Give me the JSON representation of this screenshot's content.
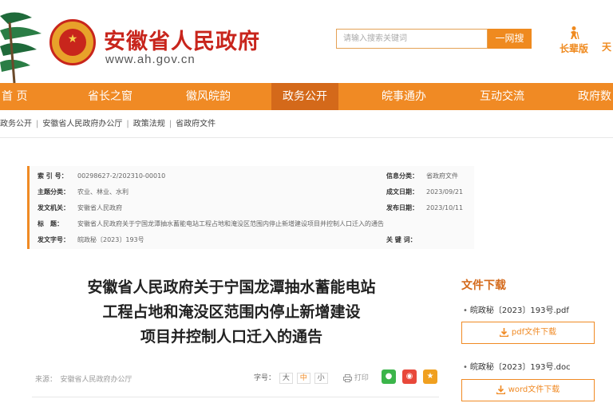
{
  "header": {
    "site_title": "安徽省人民政府",
    "site_url": "www.ah.gov.cn",
    "search_placeholder": "请输入搜索关键词",
    "search_button": "一网搜",
    "elder_mode": "长辈版",
    "extra_link": "天"
  },
  "nav": {
    "items": [
      {
        "label": "首 页"
      },
      {
        "label": "省长之窗"
      },
      {
        "label": "徽风皖韵"
      },
      {
        "label": "政务公开"
      },
      {
        "label": "皖事通办"
      },
      {
        "label": "互动交流"
      },
      {
        "label": "政府数"
      }
    ],
    "active_index": 3
  },
  "breadcrumb": [
    "政务公开",
    "安徽省人民政府办公厅",
    "政策法规",
    "省政府文件"
  ],
  "meta": {
    "index_label": "索 引 号：",
    "index_value": "00298627-2/202310-00010",
    "category_label": "信息分类：",
    "category_value": "省政府文件",
    "topic_label": "主题分类：",
    "topic_value": "农业、林业、水利",
    "date_label": "成文日期：",
    "date_value": "2023/09/21",
    "issuer_label": "发文机关：",
    "issuer_value": "安徽省人民政府",
    "pub_label": "发布日期：",
    "pub_value": "2023/10/11",
    "title_label": "标　题：",
    "title_value": "安徽省人民政府关于宁国龙潭抽水蓄能电站工程占地和淹没区范围内停止新增建设项目并控制人口迁入的通告",
    "doc_no_label": "发文字号：",
    "doc_no_value": "皖政秘〔2023〕193号",
    "keyword_label": "关 键 词："
  },
  "article": {
    "title_line1": "安徽省人民政府关于宁国龙潭抽水蓄能电站",
    "title_line2": "工程占地和淹没区范围内停止新增建设",
    "title_line3": "项目并控制人口迁入的通告",
    "source": "来源：　安徽省人民政府办公厅",
    "font_size_label": "字号：",
    "font_large": "大",
    "font_medium": "中",
    "font_small": "小",
    "print_label": "打印"
  },
  "downloads": {
    "title": "文件下载",
    "files": [
      {
        "name": "皖政秘〔2023〕193号.pdf",
        "button": "pdf文件下载"
      },
      {
        "name": "皖政秘〔2023〕193号.doc",
        "button": "word文件下载"
      }
    ]
  },
  "colors": {
    "accent": "#f08a24",
    "accent_dark": "#d4691a",
    "brand_red": "#c8251c",
    "wechat": "#3bb54a",
    "weibo": "#e8483a",
    "favorite": "#f0a020"
  },
  "icons": [
    "pine-decoration",
    "national-emblem-icon",
    "elder-icon",
    "print-icon",
    "wechat-icon",
    "weibo-icon",
    "star-icon",
    "download-icon"
  ]
}
